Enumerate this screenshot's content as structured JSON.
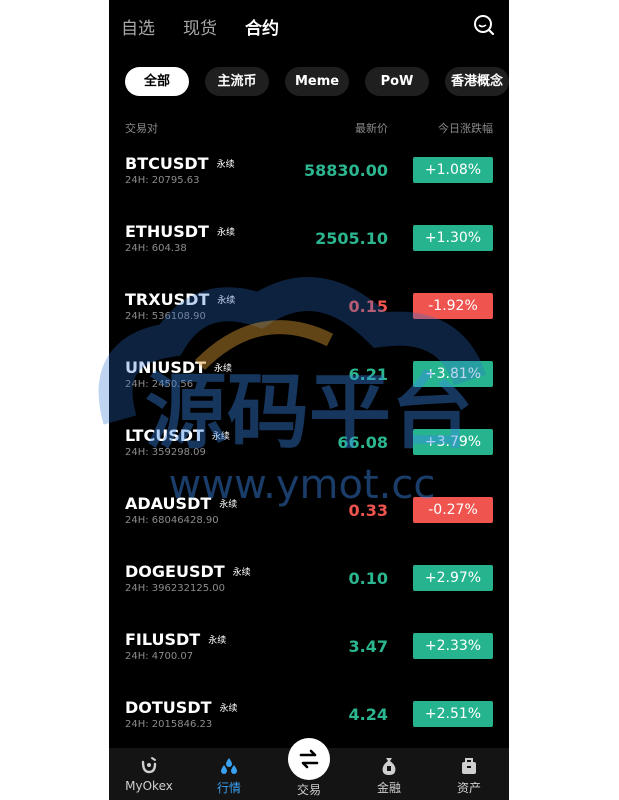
{
  "topnav": {
    "tabs": [
      "自选",
      "现货",
      "合约"
    ],
    "active_index": 2
  },
  "filters": [
    {
      "label": "全部",
      "active": true
    },
    {
      "label": "主流币",
      "active": false
    },
    {
      "label": "Meme",
      "active": false
    },
    {
      "label": "PoW",
      "active": false
    },
    {
      "label": "香港概念",
      "active": false
    }
  ],
  "columns": {
    "pair": "交易对",
    "price": "最新价",
    "change": "今日涨跌幅"
  },
  "rows": [
    {
      "symbol": "BTCUSDT",
      "tag": "永续",
      "volume": "24H: 20795.63",
      "price": "58830.00",
      "change": "+1.08%",
      "dir": "up"
    },
    {
      "symbol": "ETHUSDT",
      "tag": "永续",
      "volume": "24H: 604.38",
      "price": "2505.10",
      "change": "+1.30%",
      "dir": "up"
    },
    {
      "symbol": "TRXUSDT",
      "tag": "永续",
      "volume": "24H: 536108.90",
      "price": "0.15",
      "change": "-1.92%",
      "dir": "down"
    },
    {
      "symbol": "UNIUSDT",
      "tag": "永续",
      "volume": "24H: 2450.56",
      "price": "6.21",
      "change": "+3.81%",
      "dir": "up"
    },
    {
      "symbol": "LTCUSDT",
      "tag": "永续",
      "volume": "24H: 359298.09",
      "price": "66.08",
      "change": "+3.79%",
      "dir": "up"
    },
    {
      "symbol": "ADAUSDT",
      "tag": "永续",
      "volume": "24H: 68046428.90",
      "price": "0.33",
      "change": "-0.27%",
      "dir": "down"
    },
    {
      "symbol": "DOGEUSDT",
      "tag": "永续",
      "volume": "24H: 396232125.00",
      "price": "0.10",
      "change": "+2.97%",
      "dir": "up"
    },
    {
      "symbol": "FILUSDT",
      "tag": "永续",
      "volume": "24H: 4700.07",
      "price": "3.47",
      "change": "+2.33%",
      "dir": "up"
    },
    {
      "symbol": "DOTUSDT",
      "tag": "永续",
      "volume": "24H: 2015846.23",
      "price": "4.24",
      "change": "+2.51%",
      "dir": "up"
    }
  ],
  "watermark": {
    "line1": "源码平台",
    "line2": "www.ymot.cc"
  },
  "bottom_nav": {
    "myokex": "MyOkex",
    "market": "行情",
    "trade": "交易",
    "finance": "金融",
    "assets": "资产"
  },
  "colors": {
    "up": "#26b48f",
    "down": "#f0544f",
    "accent": "#3aa0f0"
  }
}
